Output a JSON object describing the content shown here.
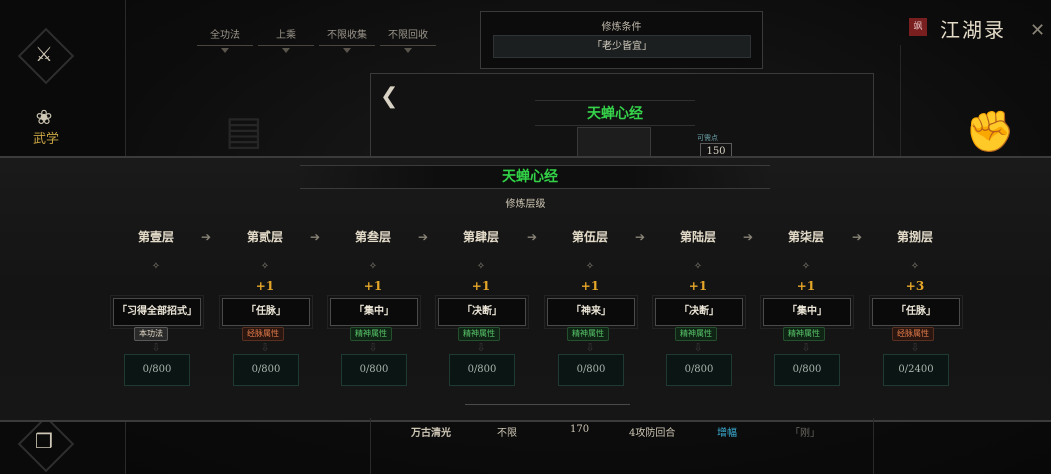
{
  "app": {
    "title": "江湖录",
    "seal": "飒"
  },
  "nav": {
    "martial_label": "武学"
  },
  "filters": [
    "全功法",
    "上乘",
    "不限收集",
    "不限回收"
  ],
  "condition": {
    "title": "修炼条件",
    "value": "「老少皆宜」"
  },
  "background_card": {
    "title": "天蝉心经",
    "badge_label": "可需点",
    "badge_value": "150"
  },
  "panel": {
    "title": "天蝉心经",
    "subtitle": "修炼层级",
    "tiers": [
      {
        "name": "第壹层",
        "bonus": "",
        "skill": "「习得全部招式」",
        "tag": "本功法",
        "tag_type": "self",
        "progress": "0/800"
      },
      {
        "name": "第贰层",
        "bonus": "+1",
        "skill": "「任脉」",
        "tag": "经脉属性",
        "tag_type": "orange",
        "progress": "0/800"
      },
      {
        "name": "第叁层",
        "bonus": "+1",
        "skill": "「集中」",
        "tag": "精神属性",
        "tag_type": "green",
        "progress": "0/800"
      },
      {
        "name": "第肆层",
        "bonus": "+1",
        "skill": "「决断」",
        "tag": "精神属性",
        "tag_type": "green",
        "progress": "0/800"
      },
      {
        "name": "第伍层",
        "bonus": "+1",
        "skill": "「神来」",
        "tag": "精神属性",
        "tag_type": "green",
        "progress": "0/800"
      },
      {
        "name": "第陆层",
        "bonus": "+1",
        "skill": "「决断」",
        "tag": "精神属性",
        "tag_type": "green",
        "progress": "0/800"
      },
      {
        "name": "第柒层",
        "bonus": "+1",
        "skill": "「集中」",
        "tag": "精神属性",
        "tag_type": "green",
        "progress": "0/800"
      },
      {
        "name": "第捌层",
        "bonus": "+3",
        "skill": "「任脉」",
        "tag": "经脉属性",
        "tag_type": "orange",
        "progress": "0/2400"
      }
    ]
  },
  "bottom_row": {
    "name": "万古清光",
    "limit": "不限",
    "value": "170",
    "effect": "4攻防回合",
    "type": "增幅",
    "extra": "「刚」"
  },
  "colors": {
    "accent_green": "#32d247",
    "bonus_orange": "#e6a728",
    "highlight_blue": "#3bb1d8"
  }
}
